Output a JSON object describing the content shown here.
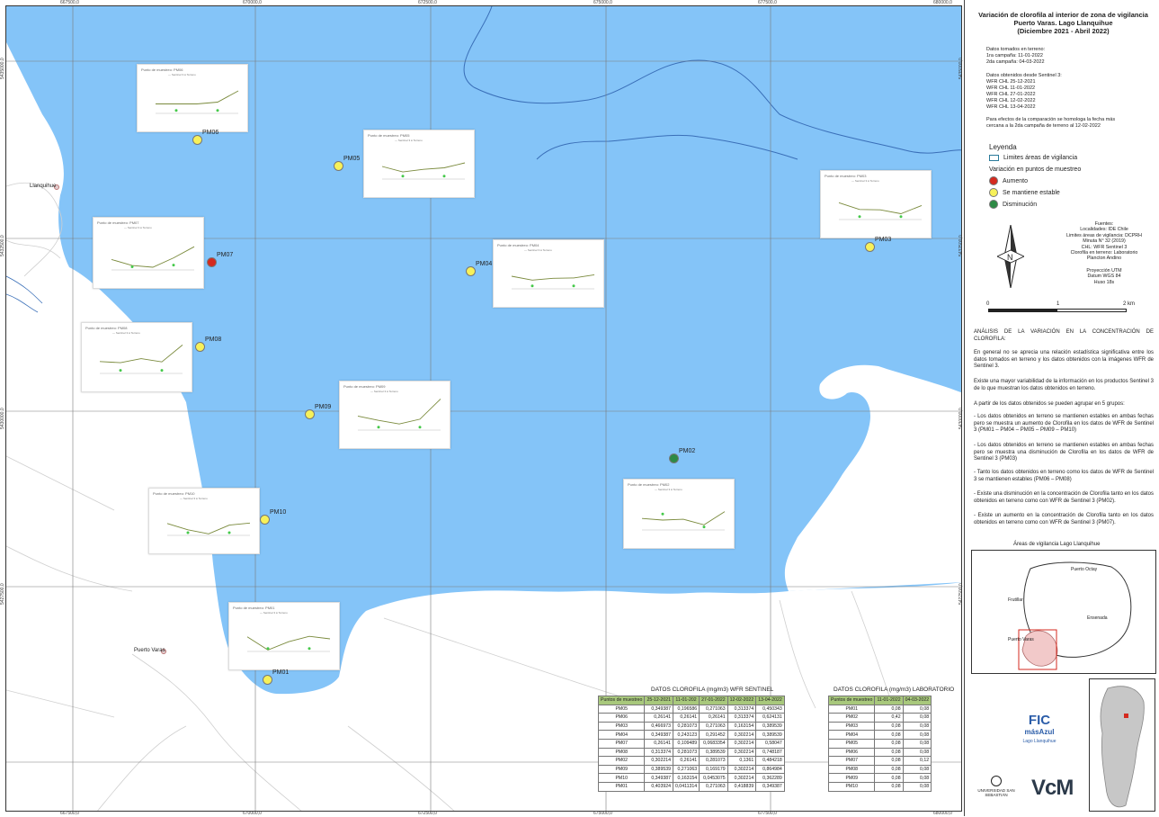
{
  "map": {
    "grid_x_labels": [
      "667500,0",
      "670000,0",
      "672500,0",
      "675000,0",
      "677500,0",
      "680000,0"
    ],
    "grid_y_labels": [
      "5435000,0",
      "5432500,0",
      "5430000,0",
      "5427500,0"
    ],
    "towns": [
      "Llanquihue",
      "Puerto Varas"
    ],
    "points": [
      {
        "id": "PM06",
        "label": "PM06",
        "status": "stable"
      },
      {
        "id": "PM05",
        "label": "PM05",
        "status": "stable"
      },
      {
        "id": "PM07",
        "label": "PM07",
        "status": "increase"
      },
      {
        "id": "PM03",
        "label": "PM03",
        "status": "stable"
      },
      {
        "id": "PM04",
        "label": "PM04",
        "status": "stable"
      },
      {
        "id": "PM08",
        "label": "PM08",
        "status": "stable"
      },
      {
        "id": "PM09",
        "label": "PM09",
        "status": "stable"
      },
      {
        "id": "PM02",
        "label": "PM02",
        "status": "decrease"
      },
      {
        "id": "PM10",
        "label": "PM10",
        "status": "stable"
      },
      {
        "id": "PM01",
        "label": "PM01",
        "status": "stable"
      }
    ],
    "minicharts": [
      {
        "id": "PM06",
        "title": "Punto de muestreo: PM06"
      },
      {
        "id": "PM05",
        "title": "Punto de muestreo: PM05"
      },
      {
        "id": "PM07",
        "title": "Punto de muestreo: PM07"
      },
      {
        "id": "PM03",
        "title": "Punto de muestreo: PM03"
      },
      {
        "id": "PM04",
        "title": "Punto de muestreo: PM04"
      },
      {
        "id": "PM08",
        "title": "Punto de muestreo: PM08"
      },
      {
        "id": "PM09",
        "title": "Punto de muestreo: PM09"
      },
      {
        "id": "PM02",
        "title": "Punto de muestreo: PM02"
      },
      {
        "id": "PM10",
        "title": "Punto de muestreo: PM10"
      },
      {
        "id": "PM01",
        "title": "Punto de muestreo: PM01"
      }
    ],
    "chart_legend": "— Sentinel 3   ● Terreno"
  },
  "colors": {
    "lake": "#84c4f8",
    "land": "#ffffff",
    "increase": "#d42a1f",
    "stable": "#f7f15a",
    "decrease": "#2d8a45",
    "header_green": "#a8c87c"
  },
  "panel": {
    "title_line1": "Variación de clorofila al interior de zona de vigilancia",
    "title_line2": "Puerto Varas. Lago Llanquihue",
    "title_line3": "(Diciembre 2021 - Abril 2022)",
    "field_header": "Datos tomados en terreno:",
    "field_1": "1ra campaña: 11-01-2022",
    "field_2": "2da campaña: 04-03-2022",
    "s3_header": "Datos obtenidos desde Sentinel 3:",
    "s3_1": "WFR CHL 25-12-2021",
    "s3_2": "WFR CHL 11-01-2022",
    "s3_3": "WFR CHL 27-01-2022",
    "s3_4": "WFR CHL 12-02-2022",
    "s3_5": "WFR CHL 13-04-2022",
    "note_1": "Para efectos de la comparación se homologa la fecha más",
    "note_2": "cercana a la 2da campaña de terreno al 12-02-2022",
    "legend_title": "Leyenda",
    "legend_area": "Limites áreas de vigilancia",
    "legend_var": "Variación en puntos de muestreo",
    "legend_up": "Aumento",
    "legend_stable": "Se mantiene estable",
    "legend_down": "Disminución",
    "sources_1": "Fuentes:",
    "sources_2": "Localidades: IDE Chile",
    "sources_3": "Limites áreas de vigilancia: DCPRH",
    "sources_4": "Minuta N° 32 (2019)",
    "sources_5": "CHL: WFR Sentinel 3",
    "sources_6": "Clorofila en terreno: Laboratorio",
    "sources_7": "Plancton Andino",
    "proj_1": "Proyección UTM",
    "proj_2": "Datum WGS 84",
    "proj_3": "Huso 18s",
    "scale_0": "0",
    "scale_1": "1",
    "scale_2": "2 km",
    "an_title": "ANÁLISIS DE LA VARIACIÓN EN LA CONCENTRACIÓN DE CLOROFILA:",
    "an_p1": "En general no se aprecia una relación estadística significativa entre los datos tomados en terreno y los datos obtenidos con la imágenes WFR de Sentinel 3.",
    "an_p2": "Existe una mayor variabilidad de la información en los productos Sentinel 3 de lo que muestran los datos obtenidos en terreno.",
    "an_p3": "A partir de los datos obtenidos se pueden agrupar en 5 grupos:",
    "an_p4": "- Los datos obtenidos en terreno se mantienen estables en ambas fechas pero se muestra un aumento de Clorofila en los datos de WFR de Sentinel 3 (PM01 – PM04 – PM05 – PM09 – PM10)",
    "an_p5": "- Los datos obtenidos en terreno se mantienen estables en ambas fechas pero se muestra una disminución de Clorofila en los datos de WFR de Sentinel 3 (PM03)",
    "an_p6": "- Tanto los datos obtenidos en terreno como los datos de WFR de Sentinel 3 se mantienen estables (PM06 – PM08)",
    "an_p7": "- Existe una disminución en la concentración de Clorofila tanto en los datos obtenidos en terreno como con WFR de Sentinel 3 (PM02).",
    "an_p8": "- Existe un aumento en la concentración de Clorofila tanto en los datos obtenidos en terreno como con WFR de Sentinel 3 (PM07).",
    "inset_title": "Áreas de vigilancia Lago Llanquihue",
    "inset_labels": [
      "Puerto Octay",
      "Frutillar",
      "Ensenada",
      "Puerto Varas"
    ],
    "logo_fic": "FIC",
    "logo_masazul": "másAzul",
    "logo_sub": "Lago Llanquihue",
    "logo_uss": "UNIVERSIDAD SAN SEBASTIÁN",
    "logo_vcm": "VcM"
  },
  "tables": {
    "sentinel_title": "DATOS CLOROFILA (mg/m3) WFR SENTINEL",
    "sentinel_headers": [
      "Puntos de muestreo",
      "25-12-2021",
      "11-01-202",
      "27-01-2022",
      "12-02-2022",
      "13-04-2022"
    ],
    "sentinel_rows": [
      [
        "PM05",
        "0,349387",
        "0,196586",
        "0,271063",
        "0,313374",
        "0,450343"
      ],
      [
        "PM06",
        "0,26141",
        "0,26141",
        "0,26141",
        "0,313374",
        "0,624131"
      ],
      [
        "PM03",
        "0,466973",
        "0,281073",
        "0,271063",
        "0,163154",
        "0,389539"
      ],
      [
        "PM04",
        "0,349387",
        "0,243123",
        "0,291452",
        "0,302214",
        "0,389539"
      ],
      [
        "PM07",
        "0,26141",
        "0,109489",
        "0,0683354",
        "0,302214",
        "0,58047"
      ],
      [
        "PM08",
        "0,313374",
        "0,281073",
        "0,389539",
        "0,302214",
        "0,748187"
      ],
      [
        "PM02",
        "0,302214",
        "0,26141",
        "0,281073",
        "0,1361",
        "0,484218"
      ],
      [
        "PM09",
        "0,389539",
        "0,271063",
        "0,169179",
        "0,302214",
        "0,864984"
      ],
      [
        "PM10",
        "0,349387",
        "0,163154",
        "0,0453075",
        "0,302214",
        "0,362289"
      ],
      [
        "PM01",
        "0,403924",
        "0,0411314",
        "0,271063",
        "0,418839",
        "0,349387"
      ]
    ],
    "lab_title": "DATOS CLOROFILA (mg/m3) LABORATORIO",
    "lab_headers": [
      "Puntos de muestreo",
      "11-01-2022",
      "04-03-2022"
    ],
    "lab_rows": [
      [
        "PM01",
        "0,08",
        "0,08"
      ],
      [
        "PM02",
        "0,42",
        "0,08"
      ],
      [
        "PM03",
        "0,08",
        "0,08"
      ],
      [
        "PM04",
        "0,08",
        "0,08"
      ],
      [
        "PM05",
        "0,08",
        "0,08"
      ],
      [
        "PM06",
        "0,08",
        "0,08"
      ],
      [
        "PM07",
        "0,08",
        "0,12"
      ],
      [
        "PM08",
        "0,08",
        "0,08"
      ],
      [
        "PM09",
        "0,08",
        "0,08"
      ],
      [
        "PM10",
        "0,08",
        "0,08"
      ]
    ]
  }
}
